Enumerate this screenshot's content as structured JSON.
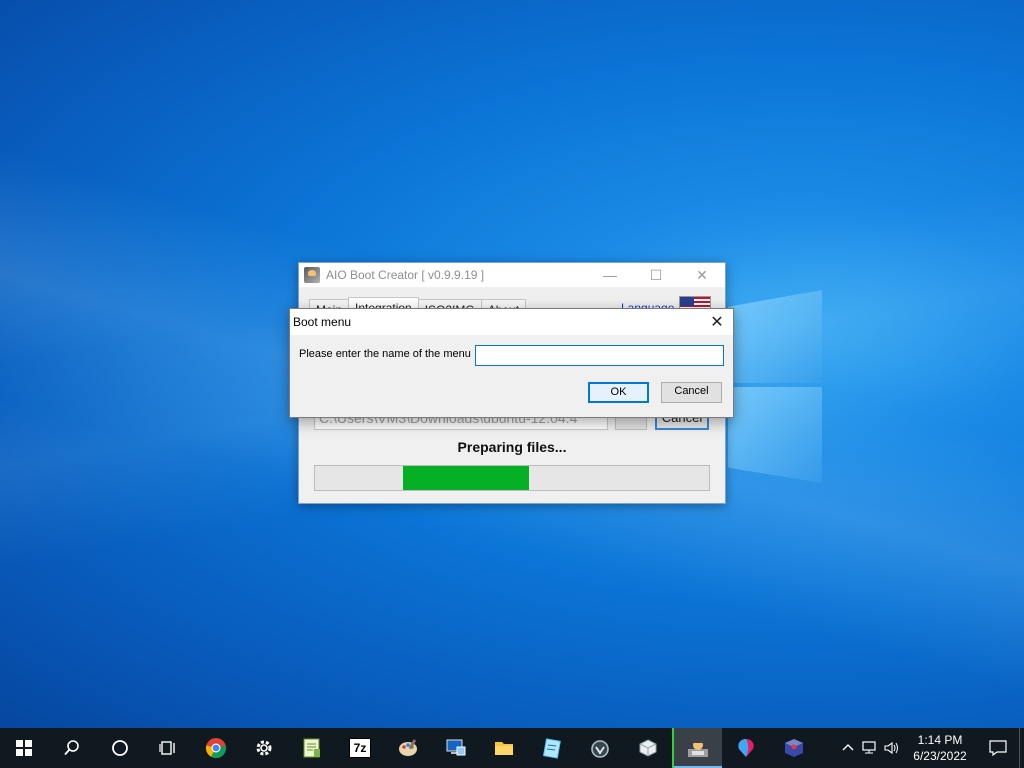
{
  "app_window": {
    "title": "AIO Boot Creator [ v0.9.9.19 ]",
    "controls": {
      "minimize": "—",
      "maximize": "☐",
      "close": "✕"
    },
    "tabs": [
      {
        "label": "Main"
      },
      {
        "label": "Integration"
      },
      {
        "label": "ISO2IMG"
      },
      {
        "label": "About"
      }
    ],
    "language_label": "Language",
    "path_value": "C:\\Users\\VM3\\Downloads\\ubuntu-12.04.4",
    "cancel_label": "Cancel",
    "status_text": "Preparing files...",
    "progress_percent": 32,
    "progress_color": "#06b025"
  },
  "dialog": {
    "title": "Boot menu",
    "close_glyph": "✕",
    "prompt": "Please enter the name of the menu",
    "input_value": "",
    "ok_label": "OK",
    "cancel_label": "Cancel"
  },
  "taskbar": {
    "apps": [
      {
        "name": "start-icon"
      },
      {
        "name": "search-icon"
      },
      {
        "name": "cortana-icon"
      },
      {
        "name": "task-view-icon"
      },
      {
        "name": "chrome-icon"
      },
      {
        "name": "settings-icon"
      },
      {
        "name": "notepad-plus-plus-icon"
      },
      {
        "name": "7zip-icon",
        "label": "7z"
      },
      {
        "name": "paint-icon"
      },
      {
        "name": "remote-desktop-icon"
      },
      {
        "name": "file-explorer-icon"
      },
      {
        "name": "notepad-icon"
      },
      {
        "name": "ventoy-icon"
      },
      {
        "name": "virtualbox-icon"
      },
      {
        "name": "aio-boot-icon",
        "active": true
      },
      {
        "name": "copilot-icon"
      },
      {
        "name": "package-icon"
      }
    ],
    "clock": {
      "time": "1:14 PM",
      "date": "6/23/2022"
    }
  }
}
